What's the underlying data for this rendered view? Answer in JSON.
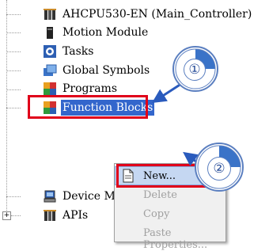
{
  "tree": {
    "items": [
      {
        "label": "AHCPU530-EN  (Main_Controller)",
        "icon": "plc-cpu-icon"
      },
      {
        "label": "Motion Module",
        "icon": "motion-module-icon"
      },
      {
        "label": "Tasks",
        "icon": "tasks-icon"
      },
      {
        "label": "Global Symbols",
        "icon": "global-symbols-icon"
      },
      {
        "label": "Programs",
        "icon": "programs-icon"
      },
      {
        "label": "Function Blocks",
        "icon": "function-blocks-icon"
      },
      {
        "label": "Device M",
        "icon": "device-manager-icon"
      },
      {
        "label": "APIs",
        "icon": "apis-icon"
      }
    ],
    "expander": "+"
  },
  "context_menu": {
    "items": [
      {
        "label": "New...",
        "state": "highlighted"
      },
      {
        "label": "Delete",
        "state": "disabled"
      },
      {
        "label": "Copy",
        "state": "disabled"
      },
      {
        "label": "Paste",
        "state": "disabled"
      },
      {
        "label": "Properties...",
        "state": "disabled"
      }
    ]
  },
  "annotations": {
    "step1": "①",
    "step2": "②",
    "highlight_color": "#e0001a",
    "callout_color": "#5b7fc0"
  }
}
